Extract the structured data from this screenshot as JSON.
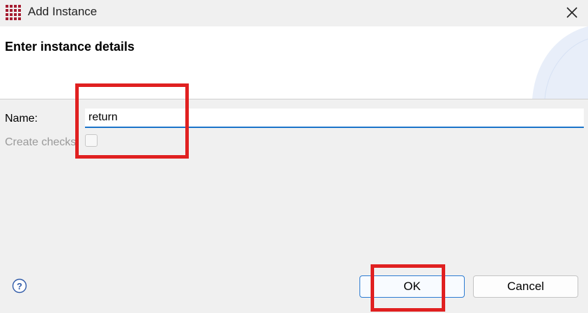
{
  "window": {
    "title": "Add Instance",
    "icons": {
      "app": "grid-logo-icon",
      "close": "close-icon"
    }
  },
  "header": {
    "heading": "Enter instance details"
  },
  "form": {
    "name_label": "Name:",
    "name_value": "return",
    "create_checks_label": "Create checks",
    "create_checks_checked": false,
    "create_checks_enabled": false
  },
  "footer": {
    "help_icon": "question-mark-icon",
    "ok_label": "OK",
    "cancel_label": "Cancel"
  },
  "colors": {
    "accent": "#1a73c9",
    "brand": "#a51c30",
    "highlight": "#e02020"
  }
}
